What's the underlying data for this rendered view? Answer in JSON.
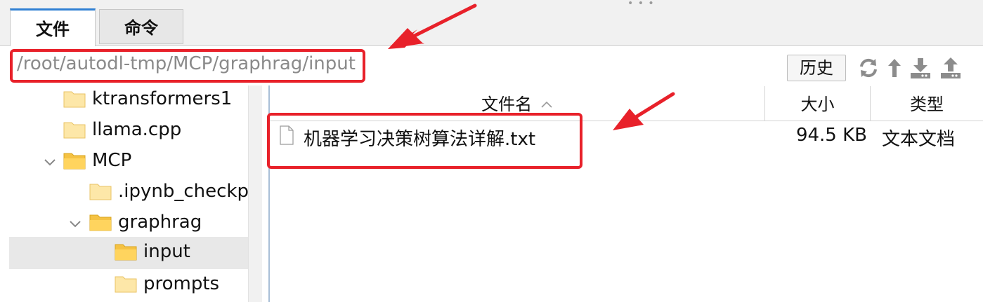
{
  "tabs": [
    {
      "label": "文件",
      "active": true
    },
    {
      "label": "命令",
      "active": false
    }
  ],
  "path": "/root/autodl-tmp/MCP/graphrag/input",
  "toolbar": {
    "history_label": "历史",
    "icons": [
      "refresh-icon",
      "up-arrow-icon",
      "download-icon",
      "upload-icon"
    ]
  },
  "tree": {
    "items": [
      {
        "label": "ktransformers1",
        "expanded": null,
        "selected": false
      },
      {
        "label": "llama.cpp",
        "expanded": null,
        "selected": false
      },
      {
        "label": "MCP",
        "expanded": true,
        "selected": false
      },
      {
        "label": ".ipynb_checkpo",
        "expanded": null,
        "selected": false
      },
      {
        "label": "graphrag",
        "expanded": true,
        "selected": false
      },
      {
        "label": "input",
        "expanded": null,
        "selected": true
      },
      {
        "label": "prompts",
        "expanded": null,
        "selected": false
      }
    ]
  },
  "file_table": {
    "columns": {
      "name": "文件名",
      "size": "大小",
      "type": "类型"
    },
    "sort": {
      "column": "name",
      "direction": "asc"
    },
    "rows": [
      {
        "name": "机器学习决策树算法详解.txt",
        "size": "94.5 KB",
        "type": "文本文档",
        "icon": "text-file-icon"
      }
    ]
  },
  "colors": {
    "highlight_red": "#e8212a",
    "accent_blue": "#2f7fd3",
    "folder_yellow": "#f5c243",
    "selection_gray": "#e8e8e8"
  }
}
